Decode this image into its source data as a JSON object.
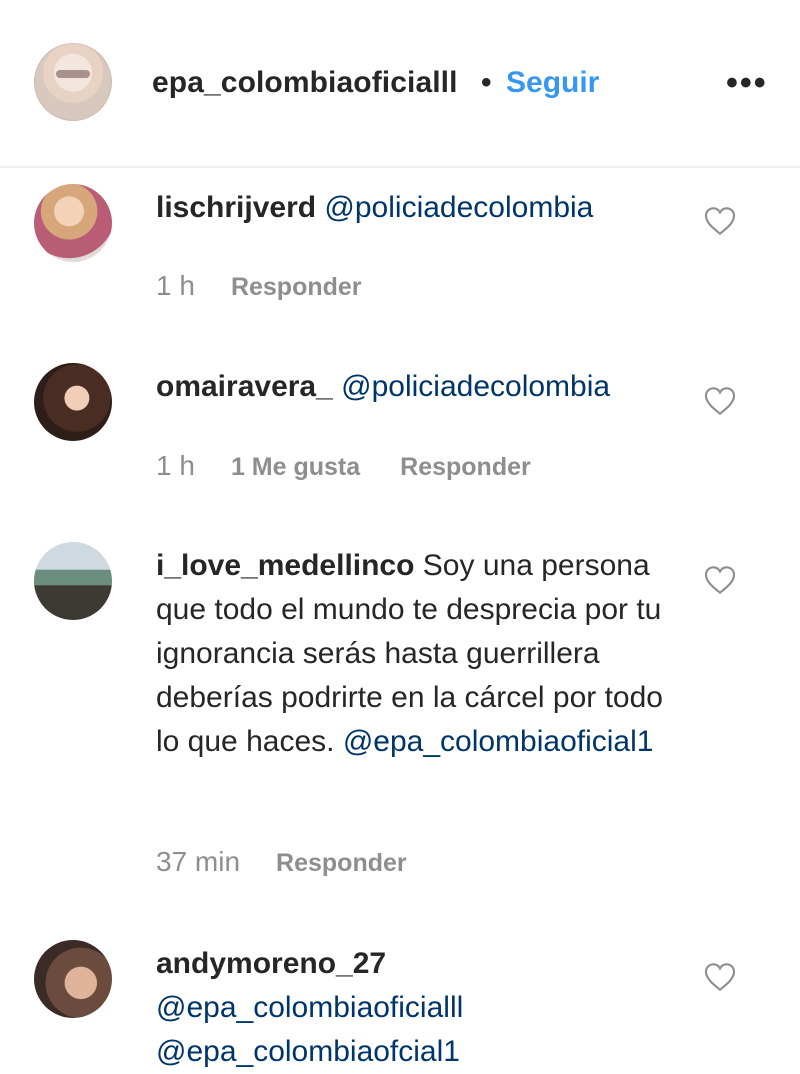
{
  "header": {
    "username": "epa_colombiaoficialll",
    "separator": "•",
    "follow_label": "Seguir",
    "more_label": "•••"
  },
  "comments": [
    {
      "username": "lischrijverd",
      "mention": "@policiadecolombia",
      "time": "1 h",
      "likes": "",
      "reply_label": "Responder"
    },
    {
      "username": "omairavera_",
      "mention": "@policiadecolombia",
      "time": "1 h",
      "likes": "1 Me gusta",
      "reply_label": "Responder"
    },
    {
      "username": "i_love_medellinco",
      "text": "Soy una persona que todo el mundo te desprecia por tu ignorancia serás hasta guerrillera deberías podrirte en la cárcel por todo lo que haces.",
      "mention": "@epa_colombiaoficial1",
      "time": "37 min",
      "likes": "",
      "reply_label": "Responder"
    },
    {
      "username": "andymoreno_27",
      "mention": "@epa_colombiaoficialll",
      "mention2": "@epa_colombiaofcial1"
    }
  ],
  "icons": {
    "like": "heart-outline-icon",
    "more": "more-horizontal-icon"
  },
  "colors": {
    "link_blue": "#3897f0",
    "mention_blue": "#003569",
    "muted_gray": "#8e8e8e",
    "text": "#262626"
  }
}
